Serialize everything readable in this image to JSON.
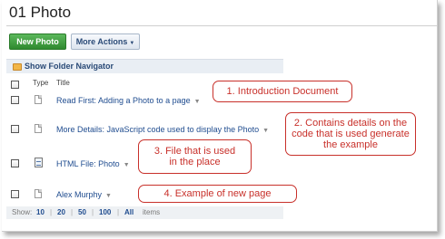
{
  "page": {
    "title": "01 Photo"
  },
  "toolbar": {
    "new_photo_label": "New Photo",
    "more_actions_label": "More Actions",
    "more_actions_caret": "▼"
  },
  "navigator": {
    "label": "Show Folder Navigator",
    "icon": "folder-icon"
  },
  "columns": {
    "type": "Type",
    "title": "Title"
  },
  "rows": [
    {
      "icon": "document-icon",
      "title": "Read First: Adding a Photo to a page",
      "caret": "▼"
    },
    {
      "icon": "document-icon",
      "title": "More Details: JavaScript code used to display the Photo",
      "caret": "▼"
    },
    {
      "icon": "html-file-icon",
      "title": "HTML File: Photo",
      "caret": "▼"
    },
    {
      "icon": "document-icon",
      "title": "Alex Murphy",
      "caret": "▼"
    }
  ],
  "pager": {
    "label": "Show:",
    "options": [
      "10",
      "20",
      "50",
      "100",
      "All"
    ],
    "separator": "|",
    "selected": "10",
    "suffix": "items"
  },
  "callouts": [
    "1. Introduction Document",
    "2. Contains details on the code that is used generate the example",
    "3. File that is used in the place",
    "4. Example of new page"
  ],
  "colors": {
    "accent_green": "#2f8a2f",
    "link_blue": "#1f4c8f",
    "callout_red": "#c8302a"
  }
}
